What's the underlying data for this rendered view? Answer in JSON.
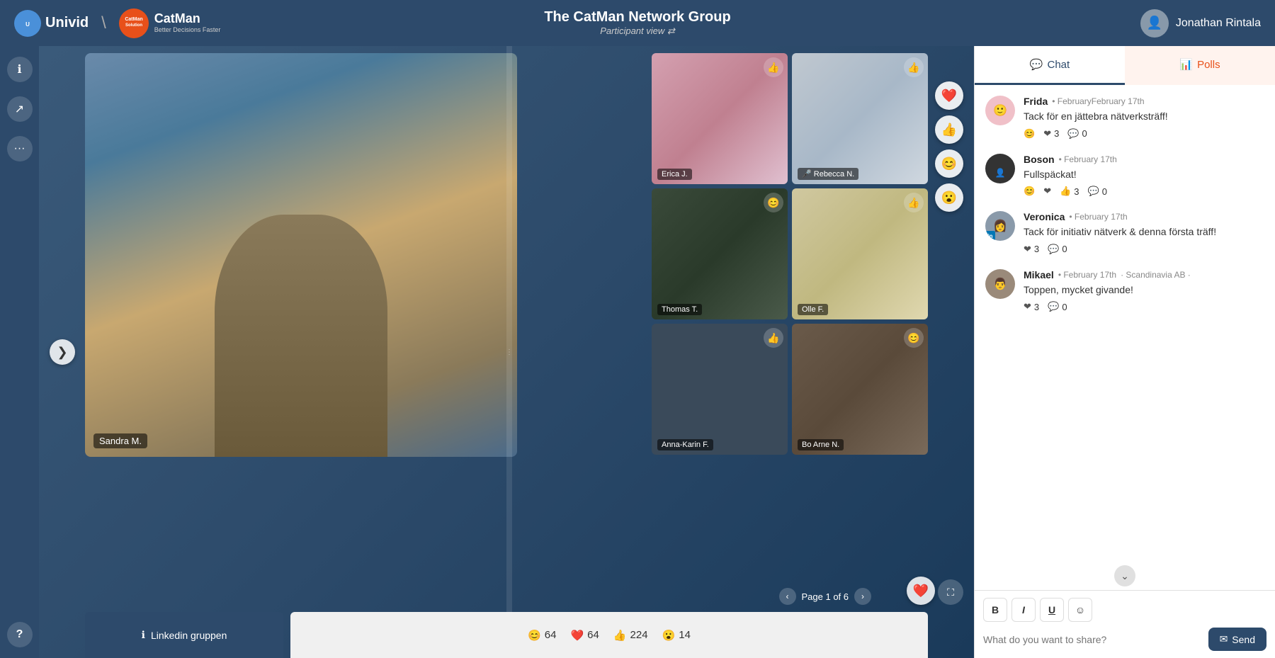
{
  "header": {
    "univid_label": "Univid",
    "catman_name": "CatMan",
    "catman_sub": "Solution",
    "catman_tagline": "Better\nDecisions\nFaster",
    "title": "The CatMan Network Group",
    "subtitle": "Participant view ⇄",
    "user_name": "Jonathan Rintala"
  },
  "sidebar": {
    "info_icon": "ℹ",
    "share_icon": "↗",
    "more_icon": "•••",
    "help_icon": "?"
  },
  "video": {
    "main_speaker": "Sandra M.",
    "nav_arrow": "❯",
    "page_info": "Page 1 of 6",
    "linkedin_btn": "Linkedin gruppen",
    "thumbnails": [
      {
        "name": "Erica J.",
        "reaction": "👍"
      },
      {
        "name": "Rebecca N.",
        "reaction": "👍",
        "mic_off": true
      },
      {
        "name": "Thomas T.",
        "reaction": "😊"
      },
      {
        "name": "Olle F.",
        "reaction": "👍"
      },
      {
        "name": "Anna-Karin F.",
        "reaction": "👍"
      },
      {
        "name": "Bo Arne N.",
        "reaction": "😊"
      }
    ],
    "reactions_bar": [
      {
        "icon": "😊",
        "count": "64"
      },
      {
        "icon": "❤️",
        "count": "64"
      },
      {
        "icon": "👍",
        "count": "224"
      },
      {
        "icon": "😮",
        "count": "14"
      }
    ],
    "floating_reactions": [
      "❤️",
      "👍",
      "😊",
      "😮"
    ]
  },
  "chat": {
    "tab_label": "Chat",
    "polls_tab_label": "Polls",
    "messages": [
      {
        "user": "Frida",
        "time": "February 17th",
        "text": "Tack för en jättebra nätverksträff!",
        "reactions": [
          {
            "icon": "😊",
            "count": ""
          },
          {
            "icon": "❤",
            "count": "3"
          },
          {
            "icon": "💬",
            "count": "0"
          }
        ],
        "avatar_type": "frida"
      },
      {
        "user": "Boson",
        "time": "February 17th",
        "text": "Fullspäckat!",
        "reactions": [
          {
            "icon": "😊",
            "count": ""
          },
          {
            "icon": "❤",
            "count": ""
          },
          {
            "icon": "👍",
            "count": "3"
          },
          {
            "icon": "💬",
            "count": "0"
          }
        ],
        "avatar_type": "boson"
      },
      {
        "user": "Veronica",
        "time": "February 17th",
        "text": "Tack för initiativ nätverk & denna första träff!",
        "reactions": [
          {
            "icon": "❤",
            "count": "3"
          },
          {
            "icon": "💬",
            "count": "0"
          }
        ],
        "avatar_type": "veronica",
        "has_linkedin": true
      },
      {
        "user": "Mikael",
        "time": "February 17th",
        "org": "· Scandinavia AB ·",
        "text": "Toppen, mycket givande!",
        "reactions": [
          {
            "icon": "❤",
            "count": "3"
          },
          {
            "icon": "💬",
            "count": "0"
          }
        ],
        "avatar_type": "mikael"
      }
    ],
    "toolbar": {
      "bold": "B",
      "italic": "I",
      "underline": "U",
      "emoji": "☺"
    },
    "input_placeholder": "What do you want to share?",
    "send_label": "Send"
  }
}
